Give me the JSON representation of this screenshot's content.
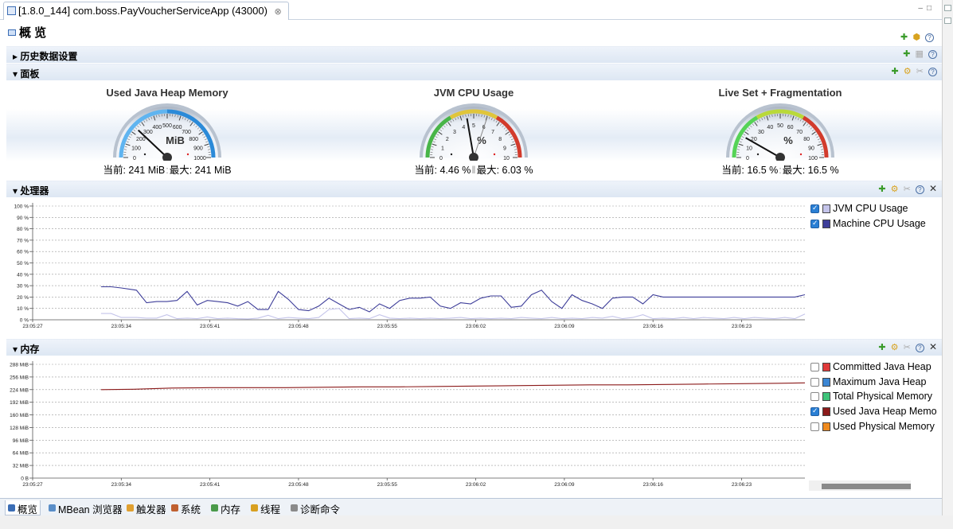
{
  "editor_tab": {
    "title": "[1.8.0_144] com.boss.PayVoucherServiceApp (43000)",
    "close": "⊗"
  },
  "overview_title": "概 览",
  "sections": {
    "history": "历史数据设置",
    "dashboard": "面板",
    "processor": "处理器",
    "memory": "内存"
  },
  "gauges": [
    {
      "title": "Used Java Heap Memory",
      "unit": "MiB",
      "ticks": [
        "0",
        "100",
        "200",
        "300",
        "400",
        "500",
        "600",
        "700",
        "800",
        "900",
        "1000"
      ],
      "value_fraction": 0.241,
      "max_fraction": 0.241,
      "arc_colors": [
        "#5fb4f0",
        "#2b8ad8"
      ],
      "current_label": "当前: 241 MiB",
      "max_label": "最大: 241 MiB"
    },
    {
      "title": "JVM CPU Usage",
      "unit": "%",
      "ticks": [
        "0",
        "1",
        "2",
        "3",
        "4",
        "5",
        "6",
        "7",
        "8",
        "9",
        "10"
      ],
      "value_fraction": 0.446,
      "max_fraction": 0.603,
      "arc_colors": [
        "#48b548",
        "#e0c53a",
        "#d23b2c"
      ],
      "current_label": "当前: 4.46 %",
      "max_label": "最大: 6.03 %"
    },
    {
      "title": "Live Set + Fragmentation",
      "unit": "%",
      "ticks": [
        "0",
        "10",
        "20",
        "30",
        "40",
        "50",
        "60",
        "70",
        "80",
        "90",
        "100"
      ],
      "value_fraction": 0.165,
      "max_fraction": 0.165,
      "arc_colors": [
        "#56d356",
        "#b9d93a",
        "#d23b2c"
      ],
      "current_label": "当前: 16.5 %",
      "max_label": "最大: 16.5 %"
    }
  ],
  "chart_data": [
    {
      "type": "line",
      "x": [
        "23:05:27",
        "23:05:34",
        "23:05:41",
        "23:05:48",
        "23:05:55",
        "23:06:02",
        "23:06:09",
        "23:06:16",
        "23:06:23"
      ],
      "y_ticks": [
        "0 %",
        "10 %",
        "20 %",
        "30 %",
        "40 %",
        "50 %",
        "60 %",
        "70 %",
        "80 %",
        "90 %",
        "100 %"
      ],
      "ylim": [
        0,
        100
      ],
      "grid": true,
      "series": [
        {
          "name": "JVM CPU Usage",
          "color": "#c4c4ea",
          "checked": true,
          "t": [
            5.4,
            6.2,
            7.0,
            8.2,
            9.0,
            9.8,
            10.6,
            11.4,
            12.2,
            13.0,
            13.8,
            14.6,
            15.4,
            16.2,
            17.0,
            17.8,
            18.6,
            19.4,
            20.2,
            21.0,
            21.8,
            22.6,
            23.4,
            24.2,
            25.0,
            25.8,
            26.6,
            27.4,
            28.2,
            29.0,
            29.8,
            30.6,
            31.4,
            32.2,
            33.0,
            33.8,
            34.6,
            35.4,
            36.2,
            37.0,
            37.8,
            38.6,
            39.4,
            40.2,
            41.0,
            41.8,
            42.6,
            43.4,
            44.2,
            45.0,
            45.8,
            46.6,
            47.4,
            48.2,
            49.0,
            49.8,
            50.6,
            51.4,
            52.2,
            53.0,
            53.8,
            54.6,
            55.4,
            56.2,
            57.0,
            57.8,
            58.6,
            59.4,
            60.2,
            61.0
          ],
          "values": [
            5.5,
            5.5,
            2.0,
            2.0,
            1.5,
            1.5,
            4.5,
            1.0,
            1.5,
            1.0,
            2.5,
            1.0,
            1.5,
            1.0,
            0.8,
            1.5,
            4.0,
            1.0,
            2.0,
            1.5,
            1.0,
            2.0,
            9.0,
            10.0,
            1.0,
            1.5,
            1.0,
            4.5,
            1.5,
            1.0,
            1.5,
            1.0,
            1.5,
            1.0,
            1.5,
            2.0,
            1.0,
            1.5,
            1.0,
            1.5,
            1.0,
            2.0,
            1.5,
            1.0,
            2.0,
            1.0,
            1.5,
            1.0,
            2.0,
            1.5,
            3.0,
            1.0,
            2.0,
            4.5,
            1.0,
            1.5,
            1.0,
            2.0,
            1.0,
            2.0,
            1.5,
            1.0,
            2.0,
            1.0,
            2.0,
            1.5,
            1.0,
            2.0,
            1.0,
            5.0
          ]
        },
        {
          "name": "Machine CPU Usage",
          "color": "#3d3d99",
          "checked": true,
          "t": [
            5.4,
            6.2,
            7.0,
            8.2,
            9.0,
            9.8,
            10.6,
            11.4,
            12.2,
            13.0,
            13.8,
            14.6,
            15.4,
            16.2,
            17.0,
            17.8,
            18.6,
            19.4,
            20.2,
            21.0,
            21.8,
            22.6,
            23.4,
            24.2,
            25.0,
            25.8,
            26.6,
            27.4,
            28.2,
            29.0,
            29.8,
            30.6,
            31.4,
            32.2,
            33.0,
            33.8,
            34.6,
            35.4,
            36.2,
            37.0,
            37.8,
            38.6,
            39.4,
            40.2,
            41.0,
            41.8,
            42.6,
            43.4,
            44.2,
            45.0,
            45.8,
            46.6,
            47.4,
            48.2,
            49.0,
            49.8,
            50.6,
            51.4,
            52.2,
            53.0,
            53.8,
            54.6,
            55.4,
            56.2,
            57.0,
            57.8,
            58.6,
            59.4,
            60.2,
            61.0
          ],
          "values": [
            29,
            29,
            28,
            26,
            15,
            16,
            16,
            17,
            25,
            13,
            17,
            16,
            15,
            12,
            16,
            9,
            9,
            25,
            18,
            9,
            8,
            12,
            19,
            14,
            9,
            11,
            7,
            14,
            10,
            17,
            19,
            19,
            20,
            12,
            10,
            15,
            14,
            19,
            21,
            21,
            11,
            12,
            22,
            26,
            16,
            10,
            22,
            17,
            14,
            10,
            19,
            20,
            20,
            14,
            22,
            20,
            20,
            20,
            20,
            20,
            20,
            20,
            20,
            20,
            20,
            20,
            20,
            20,
            20,
            22
          ]
        }
      ]
    },
    {
      "type": "line",
      "x": [
        "23:05:27",
        "23:05:34",
        "23:05:41",
        "23:05:48",
        "23:05:55",
        "23:06:02",
        "23:06:09",
        "23:06:16",
        "23:06:23"
      ],
      "y_ticks": [
        "0 B",
        "32 MiB",
        "64 MiB",
        "96 MiB",
        "128 MiB",
        "160 MiB",
        "192 MiB",
        "224 MiB",
        "256 MiB",
        "288 MiB"
      ],
      "ylim": [
        0,
        288
      ],
      "grid": true,
      "series": [
        {
          "name": "Committed Java Heap",
          "color": "#e03a3a",
          "checked": false
        },
        {
          "name": "Maximum Java Heap",
          "color": "#3b86d4",
          "checked": false
        },
        {
          "name": "Total Physical Memory",
          "color": "#3ec47a",
          "checked": false
        },
        {
          "name": "Used Java Heap Memo",
          "color": "#8b1a1a",
          "checked": true,
          "t": [
            5.4,
            8.0,
            11.0,
            14.0,
            17.0,
            20.0,
            23.0,
            26.0,
            29.0,
            32.0,
            35.0,
            38.0,
            41.0,
            44.0,
            47.0,
            50.0,
            53.0,
            56.0,
            59.0,
            61.0
          ],
          "values": [
            224,
            225,
            228,
            229,
            229,
            229,
            230,
            231,
            231,
            232,
            233,
            234,
            235,
            236,
            236,
            237,
            238,
            239,
            240,
            241
          ]
        },
        {
          "name": "Used Physical Memory",
          "color": "#ef8a1e",
          "checked": false
        }
      ]
    }
  ],
  "bottom_tabs": [
    {
      "label": "概览",
      "icon": "overview-icon",
      "color": "#3b6db5"
    },
    {
      "label": "MBean 浏览器",
      "icon": "mbean-browser-icon",
      "color": "#5a8ec8"
    },
    {
      "label": "触发器",
      "icon": "trigger-icon",
      "color": "#e0a030"
    },
    {
      "label": "系统",
      "icon": "system-icon",
      "color": "#c06030"
    },
    {
      "label": "内存",
      "icon": "memory-icon",
      "color": "#4a9a4a"
    },
    {
      "label": "线程",
      "icon": "thread-icon",
      "color": "#d8a020"
    },
    {
      "label": "诊断命令",
      "icon": "diagnostic-icon",
      "color": "#8a8a8a"
    }
  ]
}
